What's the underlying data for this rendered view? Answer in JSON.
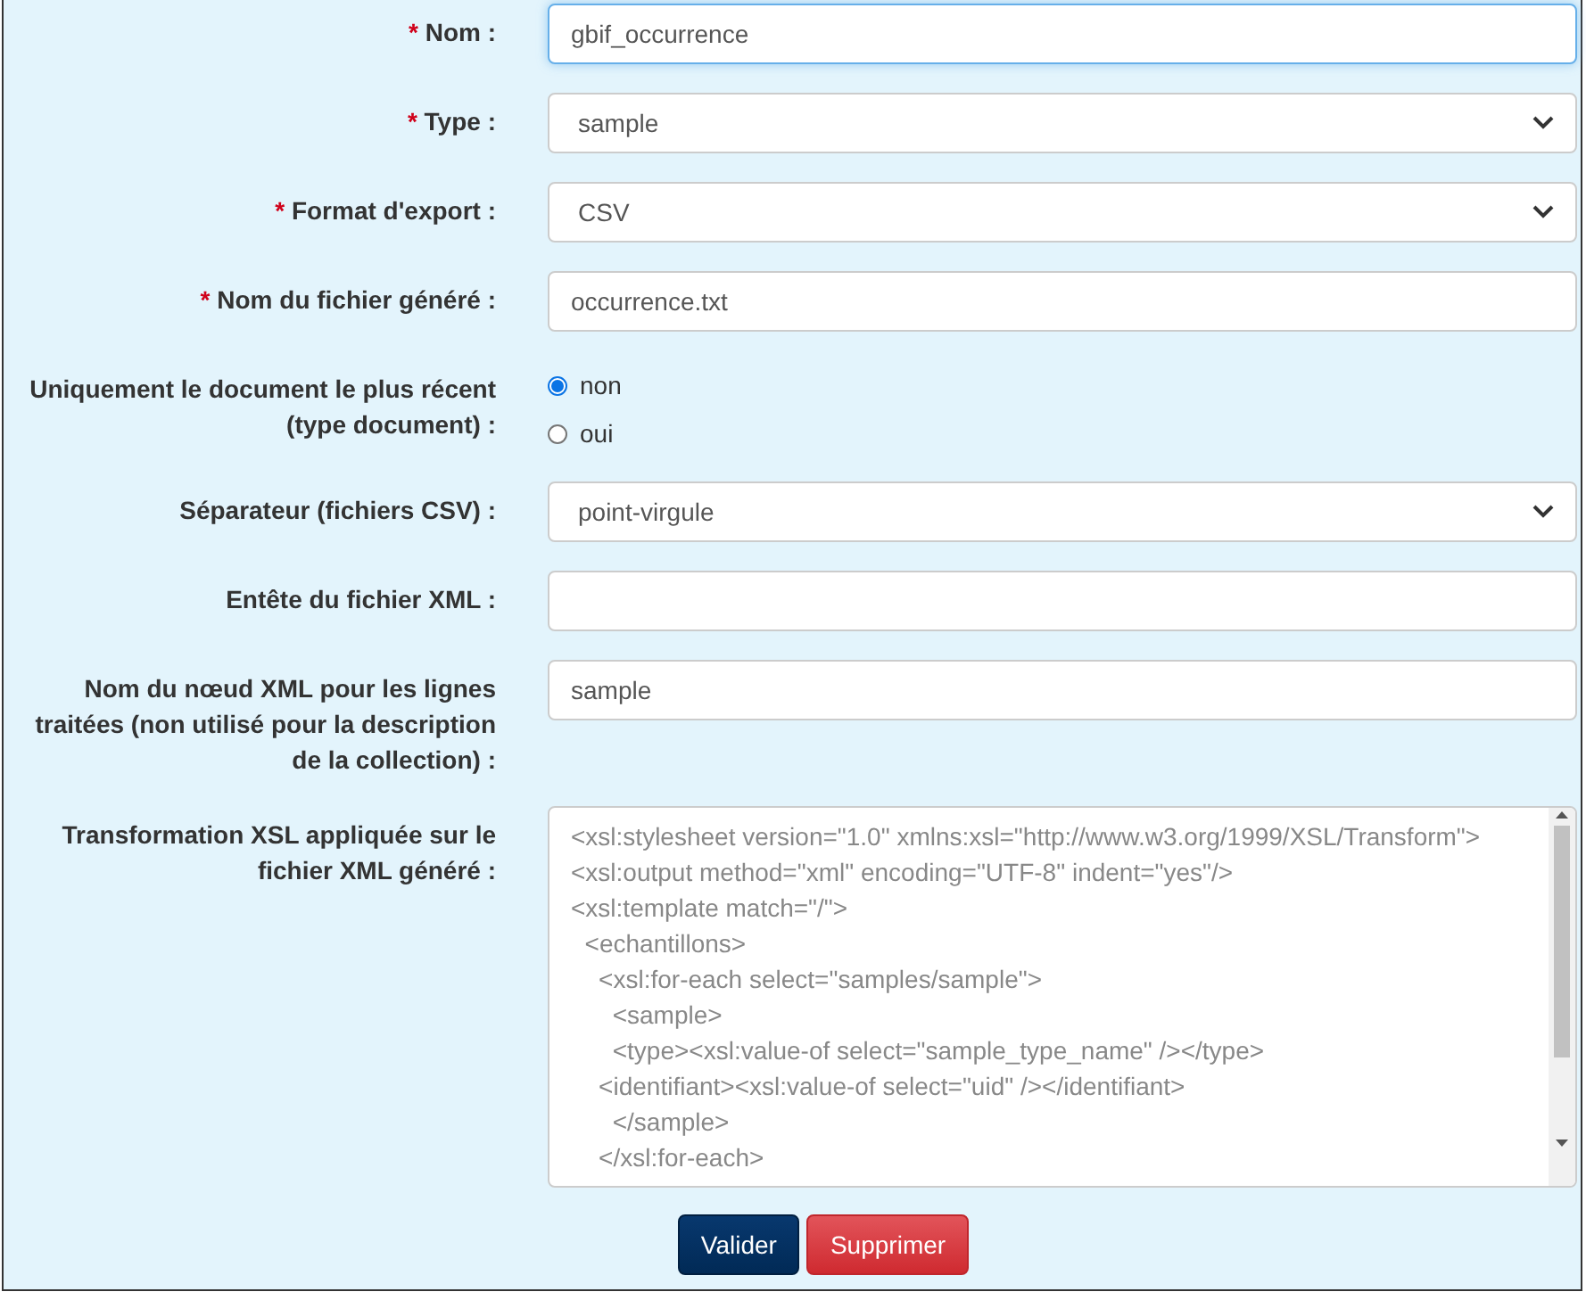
{
  "fields": [
    {
      "kind": "text",
      "label": "Nom :",
      "marker": "*",
      "value": "gbif_occurrence",
      "focused": true
    },
    {
      "kind": "select",
      "label": "Type :",
      "marker": "*",
      "value": "sample",
      "focused": false
    },
    {
      "kind": "select",
      "label": "Format d'export :",
      "marker": "*",
      "value": "CSV",
      "focused": false
    },
    {
      "kind": "text",
      "label": "Nom du fichier généré :",
      "marker": "*",
      "value": "occurrence.txt",
      "focused": false
    },
    {
      "kind": "radio",
      "label": "Uniquement le document le plus récent (type document) :",
      "options": [
        {
          "label": "non",
          "selected": true
        },
        {
          "label": "oui",
          "selected": false
        }
      ]
    },
    {
      "kind": "select",
      "label": "Séparateur (fichiers CSV) :",
      "value": "point-virgule",
      "focused": false
    },
    {
      "kind": "text",
      "label": "Entête du fichier XML :",
      "focused": false
    },
    {
      "kind": "text",
      "label": "Nom du nœud XML pour les lignes traitées (non utilisé pour la description de la collection) :",
      "value": "sample",
      "focused": false
    },
    {
      "kind": "textarea",
      "label": "Transformation XSL appliquée sur le fichier XML généré :",
      "lines": [
        "<xsl:stylesheet version=\"1.0\" xmlns:xsl=\"http://www.w3.org/1999/XSL/Transform\">",
        "<xsl:output method=\"xml\" encoding=\"UTF-8\" indent=\"yes\"/>",
        "<xsl:template match=\"/\">",
        "  <echantillons>",
        "    <xsl:for-each select=\"samples/sample\">",
        "      <sample>",
        "      <type><xsl:value-of select=\"sample_type_name\" /></type>",
        "    <identifiant><xsl:value-of select=\"uid\" /></identifiant>",
        "      </sample>",
        "    </xsl:for-each>"
      ]
    }
  ],
  "buttons": [
    {
      "label": "Valider",
      "kind": "primary"
    },
    {
      "label": "Supprimer",
      "kind": "danger"
    }
  ]
}
